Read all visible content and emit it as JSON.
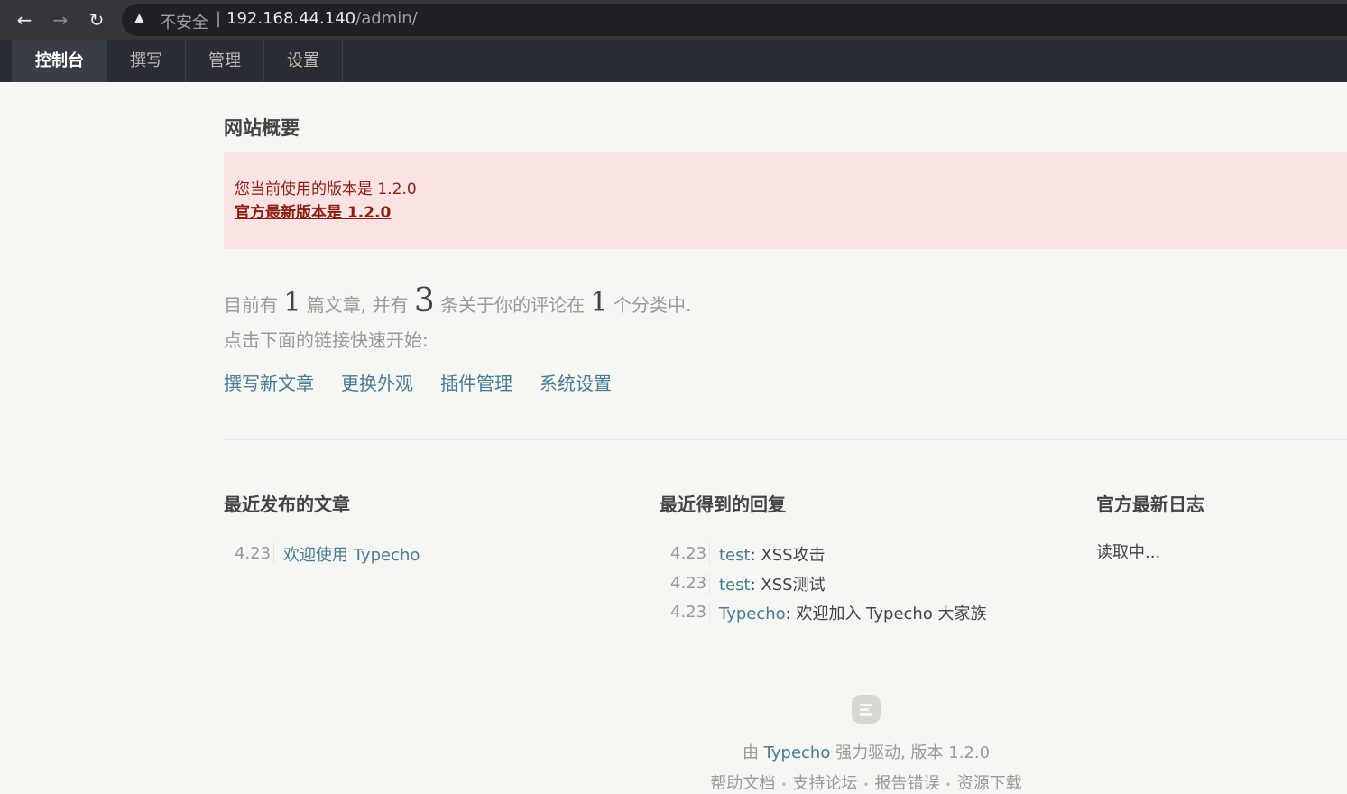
{
  "browser": {
    "back_icon": "arrow-left-icon",
    "forward_icon": "arrow-right-icon",
    "reload_icon": "reload-icon",
    "insecure_label": "不安全",
    "url_host": "192.168.44.140",
    "url_path": "/admin/"
  },
  "nav": {
    "items": [
      {
        "label": "控制台",
        "active": true
      },
      {
        "label": "撰写"
      },
      {
        "label": "管理"
      },
      {
        "label": "设置"
      }
    ]
  },
  "main": {
    "title": "网站概要",
    "notice": {
      "current": "您当前使用的版本是 1.2.0",
      "latest": "官方最新版本是 1.2.0"
    },
    "stats": {
      "prefix": "目前有",
      "posts": "1",
      "posts_suffix": "篇文章, 并有",
      "comments": "3",
      "comments_suffix": "条关于你的评论在",
      "categories": "1",
      "categories_suffix": "个分类中."
    },
    "quick_tip": "点击下面的链接快速开始:",
    "quick_links": [
      "撰写新文章",
      "更换外观",
      "插件管理",
      "系统设置"
    ],
    "recent_posts": {
      "title": "最近发布的文章",
      "items": [
        {
          "date": "4.23",
          "title": "欢迎使用 Typecho"
        }
      ]
    },
    "recent_replies": {
      "title": "最近得到的回复",
      "items": [
        {
          "date": "4.23",
          "author": "test",
          "text": ": XSS攻击"
        },
        {
          "date": "4.23",
          "author": "test",
          "text": ": XSS测试"
        },
        {
          "date": "4.23",
          "author": "Typecho",
          "text": ": 欢迎加入 Typecho 大家族"
        }
      ]
    },
    "official_log": {
      "title": "官方最新日志",
      "loading": "读取中..."
    }
  },
  "footer": {
    "powered_prefix": "由",
    "powered_link": "Typecho",
    "powered_suffix": "强力驱动, 版本 1.2.0",
    "links": [
      "帮助文档",
      "支持论坛",
      "报告错误",
      "资源下载"
    ],
    "separator": "•"
  }
}
